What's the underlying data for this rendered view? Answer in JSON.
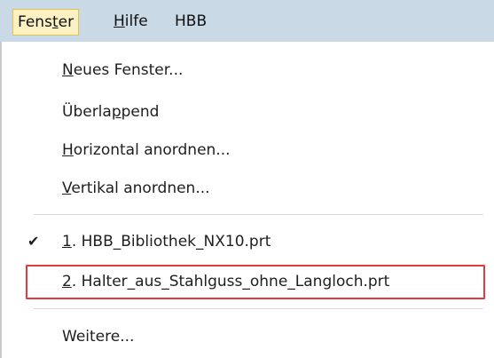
{
  "menubar": {
    "items": [
      {
        "label": "Fenster",
        "pre": "Fens",
        "mn": "t",
        "post": "er"
      },
      {
        "label": "Hilfe",
        "pre": "",
        "mn": "H",
        "post": "ilfe"
      },
      {
        "label": "HBB"
      }
    ]
  },
  "menu": {
    "items": [
      {
        "pre": "",
        "mn": "N",
        "post": "eues Fenster..."
      },
      {
        "pre": "Überla",
        "mn": "p",
        "post": "pend"
      },
      {
        "pre": "",
        "mn": "H",
        "post": "orizontal anordnen..."
      },
      {
        "pre": "",
        "mn": "V",
        "post": "ertikal anordnen..."
      },
      {
        "pre": "",
        "mn": "1",
        "post": ". HBB_Bibliothek_NX10.prt",
        "checked": true
      },
      {
        "pre": "",
        "mn": "2",
        "post": ". Halter_aus_Stahlguss_ohne_Langloch.prt",
        "highlighted": true
      },
      {
        "pre": "Weitere...",
        "mn": "",
        "post": ""
      }
    ],
    "check_glyph": "✔"
  },
  "colors": {
    "menubar_bg": "#cad9e6",
    "active_bg": "#fbf1c2",
    "active_border": "#e7c24a",
    "highlight_border": "#e23b3b"
  }
}
